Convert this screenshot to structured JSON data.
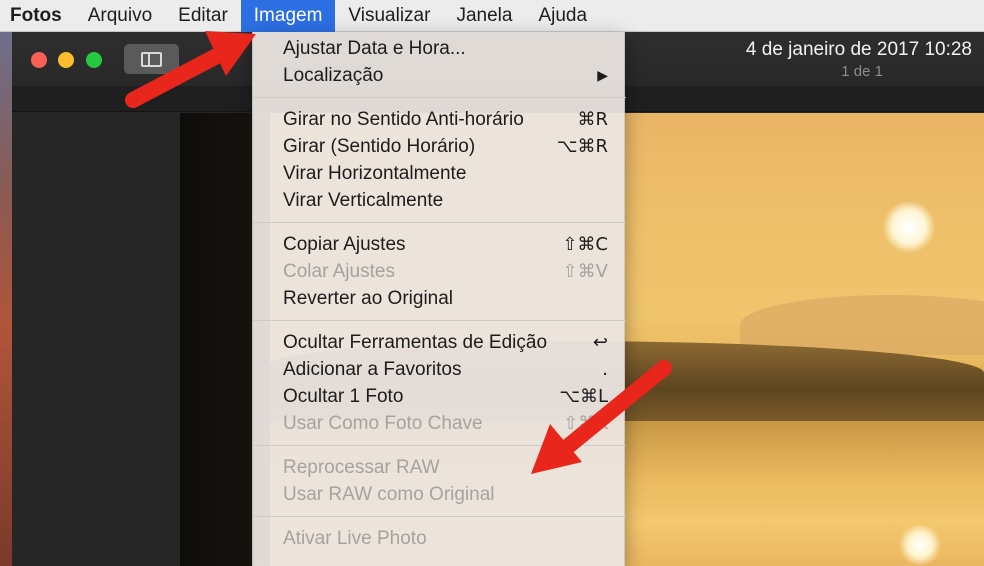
{
  "menubar": {
    "app": "Fotos",
    "items": [
      "Arquivo",
      "Editar",
      "Imagem",
      "Visualizar",
      "Janela",
      "Ajuda"
    ],
    "active": "Imagem"
  },
  "window": {
    "title": "4 de janeiro de 2017 10:28",
    "subtitle": "1 de 1"
  },
  "menu": {
    "groups": [
      [
        {
          "label": "Ajustar Data e Hora...",
          "shortcut": "",
          "enabled": true
        },
        {
          "label": "Localização",
          "shortcut": "",
          "submenu": true,
          "enabled": true
        }
      ],
      [
        {
          "label": "Girar no Sentido Anti-horário",
          "shortcut": "⌘R",
          "enabled": true
        },
        {
          "label": "Girar (Sentido Horário)",
          "shortcut": "⌥⌘R",
          "enabled": true
        },
        {
          "label": "Virar Horizontalmente",
          "shortcut": "",
          "enabled": true
        },
        {
          "label": "Virar Verticalmente",
          "shortcut": "",
          "enabled": true
        }
      ],
      [
        {
          "label": "Copiar Ajustes",
          "shortcut": "⇧⌘C",
          "enabled": true
        },
        {
          "label": "Colar Ajustes",
          "shortcut": "⇧⌘V",
          "enabled": false
        },
        {
          "label": "Reverter ao Original",
          "shortcut": "",
          "enabled": true
        }
      ],
      [
        {
          "label": "Ocultar Ferramentas de Edição",
          "shortcut": "↩",
          "enabled": true
        },
        {
          "label": "Adicionar a Favoritos",
          "shortcut": ".",
          "enabled": true
        },
        {
          "label": "Ocultar 1 Foto",
          "shortcut": "⌥⌘L",
          "enabled": true
        },
        {
          "label": "Usar Como Foto Chave",
          "shortcut": "⇧⌘K",
          "enabled": false
        }
      ],
      [
        {
          "label": "Reprocessar RAW",
          "shortcut": "",
          "enabled": false
        },
        {
          "label": "Usar RAW como Original",
          "shortcut": "",
          "enabled": false
        }
      ],
      [
        {
          "label": "Ativar Live Photo",
          "shortcut": "",
          "enabled": false
        }
      ]
    ],
    "submenu_glyph": "▶"
  },
  "colors": {
    "menu_highlight": "#2c6fe3",
    "annotation_arrow": "#e8261c"
  }
}
